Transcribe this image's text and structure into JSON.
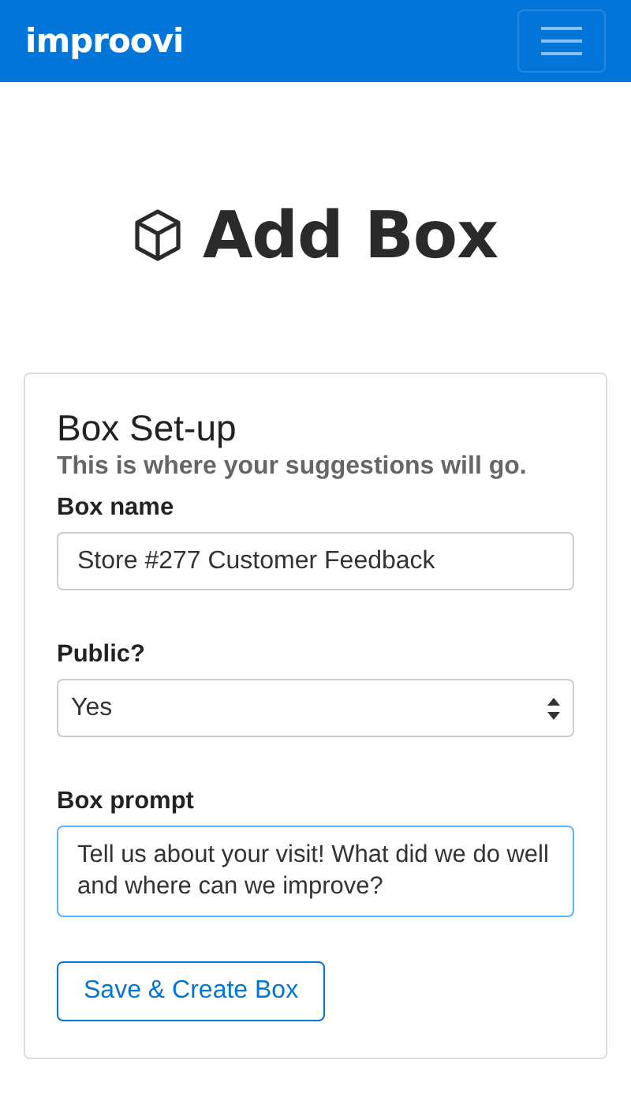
{
  "navbar": {
    "brand": "improovi"
  },
  "page_title": "Add Box",
  "card": {
    "title": "Box Set-up",
    "subtitle": "This is where your suggestions will go.",
    "fields": [
      {
        "kind": "text",
        "label": "Box name",
        "value": "Store #277 Customer Feedback",
        "focused": false
      },
      {
        "kind": "select",
        "label": "Public?",
        "value": "Yes",
        "focused": false
      },
      {
        "kind": "textarea",
        "label": "Box prompt",
        "value": "Tell us about your visit! What did we do well and where can we improve?",
        "focused": true
      }
    ],
    "button": "Save & Create Box"
  }
}
